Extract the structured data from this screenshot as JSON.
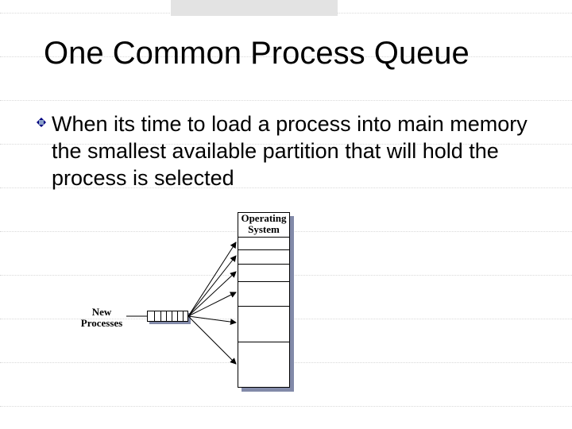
{
  "slide": {
    "title": "One Common Process Queue",
    "body": "When its time to load a process into main memory the smallest available partition that will hold the process is selected"
  },
  "diagram": {
    "new_processes_label": "New\nProcesses",
    "os_label": "Operating\nSystem",
    "queue_slots": 7,
    "memory_partitions": [
      {
        "size": 16
      },
      {
        "size": 18
      },
      {
        "size": 22
      },
      {
        "size": 30
      },
      {
        "size": 44
      },
      {
        "size": 58
      }
    ]
  },
  "colors": {
    "topbar": "#e3e3e3",
    "shadow": "#828aa9",
    "bullet_dark": "#000080",
    "bullet_light": "#8aa0c8"
  }
}
